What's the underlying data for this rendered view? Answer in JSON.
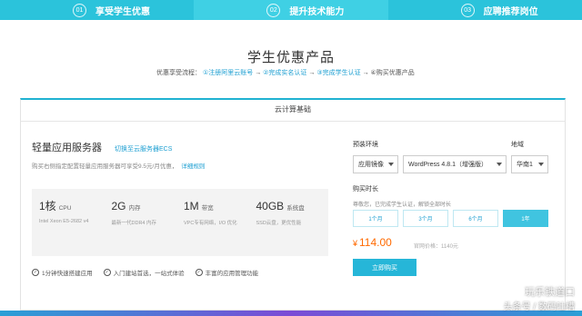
{
  "steps": [
    {
      "num": "01",
      "label": "享受学生优惠"
    },
    {
      "num": "02",
      "label": "提升技术能力"
    },
    {
      "num": "03",
      "label": "应聘推荐岗位"
    }
  ],
  "page_title": "学生优惠产品",
  "flow": {
    "prefix": "优惠享受流程：",
    "s1": "①注册阿里云账号",
    "s2": "②完成实名认证",
    "s3": "③完成学生认证",
    "s4": "④购买优惠产品",
    "arrow": "→"
  },
  "card": {
    "tab_label": "云计算基础",
    "product_name": "轻量应用服务器",
    "switch_link": "切换至云服务器ECS",
    "description": "购买右侧指定配置轻量应用服务器可享受9.5元/月优惠，",
    "detail_link": "详细规则",
    "specs": [
      {
        "value": "1核",
        "unit": "CPU",
        "sub": "Intel Xeon E5-2682 v4"
      },
      {
        "value": "2G",
        "unit": "内存",
        "sub": "最新一代DDR4 内存"
      },
      {
        "value": "1M",
        "unit": "带宽",
        "sub": "VPC专有网络，I/O 优化"
      },
      {
        "value": "40GB",
        "unit": "系统盘",
        "sub": "SSD云盘，更优性能"
      }
    ],
    "features": [
      "1分钟快速搭建应用",
      "入门建站首选，一站式体验",
      "丰富的应用管理功能"
    ],
    "env_label": "预装环境",
    "env_type": "应用镜像",
    "env_version": "WordPress 4.8.1（增强版）",
    "region_label": "地域",
    "region": "华南1",
    "duration_label": "购买时长",
    "duration_note": "尊敬您，已完成学生认证，解锁全部时长",
    "durations": [
      "1个月",
      "3个月",
      "6个月",
      "1年"
    ],
    "price_symbol": "¥",
    "price": "114.00",
    "orig_price": "官网价格：1140元",
    "buy_label": "立即购买"
  },
  "watermark": {
    "line1": "玩乐铁道口",
    "line2": "头条号 / 数码吐槽"
  },
  "colors": {
    "accent": "#1fb2d2",
    "price": "#ff6a00",
    "button": "#26b6d8"
  }
}
